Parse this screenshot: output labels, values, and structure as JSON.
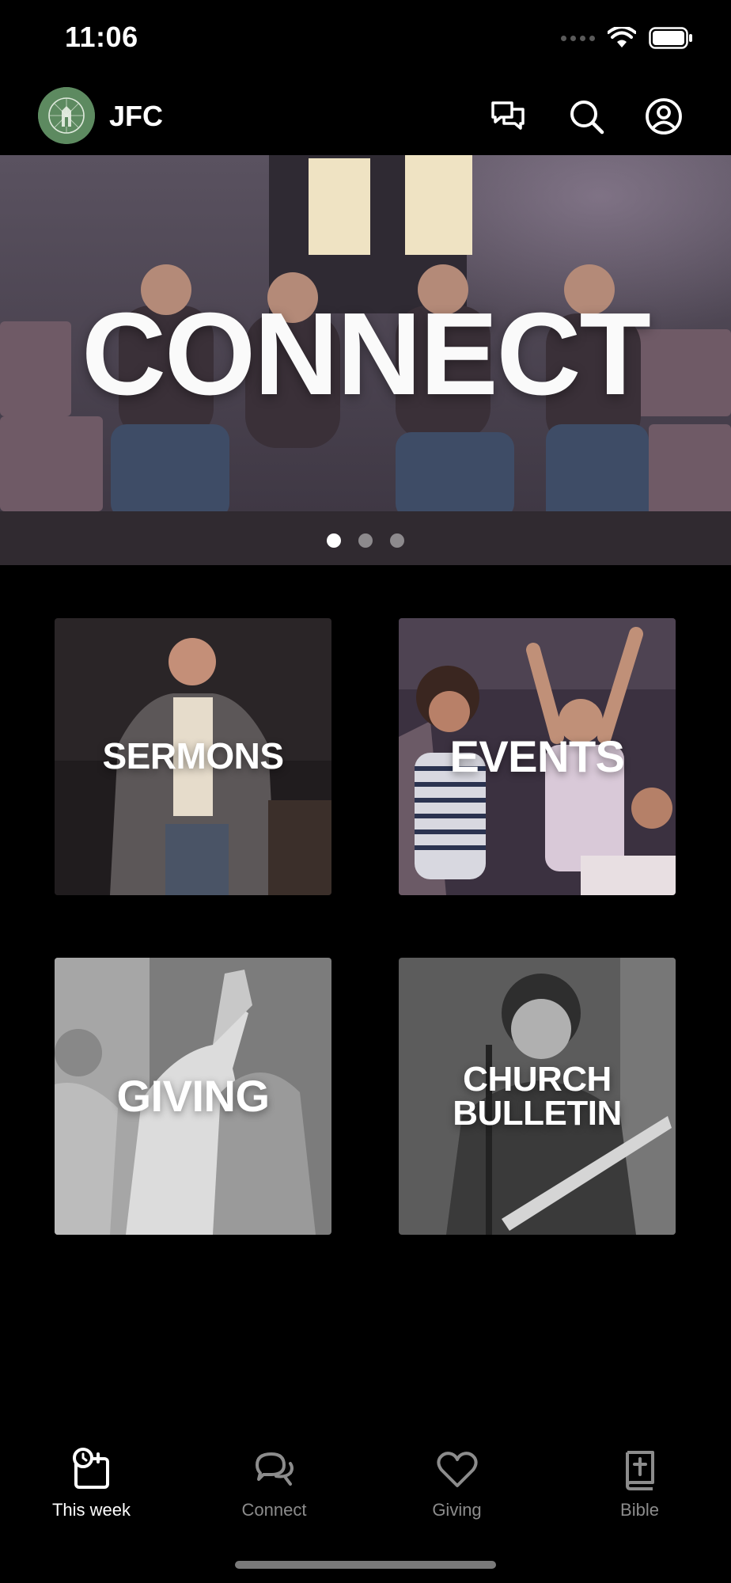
{
  "status_bar": {
    "time": "11:06"
  },
  "header": {
    "app_name": "JFC"
  },
  "hero": {
    "title": "CONNECT",
    "slides_total": 3,
    "active_slide": 1
  },
  "tiles": [
    {
      "label": "SERMONS"
    },
    {
      "label": "EVENTS"
    },
    {
      "label": "GIVING"
    },
    {
      "label": "CHURCH BULLETIN"
    }
  ],
  "bottom_nav": {
    "items": [
      {
        "label": "This week",
        "icon": "calendar-clock-icon",
        "active": true
      },
      {
        "label": "Connect",
        "icon": "chat-bubbles-icon",
        "active": false
      },
      {
        "label": "Giving",
        "icon": "heart-icon",
        "active": false
      },
      {
        "label": "Bible",
        "icon": "bible-icon",
        "active": false
      }
    ]
  },
  "colors": {
    "background": "#000000",
    "logo": "#5d8a60",
    "inactive_nav": "#8c8c8c"
  }
}
